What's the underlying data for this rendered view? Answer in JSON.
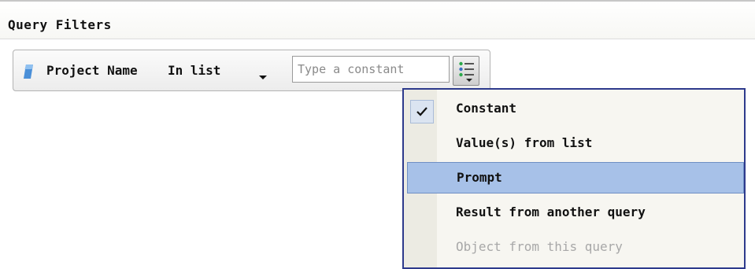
{
  "panel": {
    "title": "Query Filters"
  },
  "filter": {
    "object_icon": "dimension-icon",
    "object_name": "Project Name",
    "operator": "In list",
    "constant_placeholder": "Type a constant",
    "list_button_icon": "list-menu-icon"
  },
  "menu": {
    "items": [
      {
        "label": "Constant",
        "checked": true,
        "selected": false,
        "enabled": true
      },
      {
        "label": "Value(s) from list",
        "checked": false,
        "selected": false,
        "enabled": true
      },
      {
        "label": "Prompt",
        "checked": false,
        "selected": true,
        "enabled": true
      },
      {
        "label": "Result from another query",
        "checked": false,
        "selected": false,
        "enabled": true
      },
      {
        "label": "Object from this query",
        "checked": false,
        "selected": false,
        "enabled": false
      }
    ]
  },
  "colors": {
    "menu_border": "#2d3a8c",
    "menu_highlight": "#a7c1e8",
    "dimension_icon": "#4a8fd8",
    "list_icon_green": "#2aa84a",
    "list_icon_blue": "#3a6fc4"
  }
}
